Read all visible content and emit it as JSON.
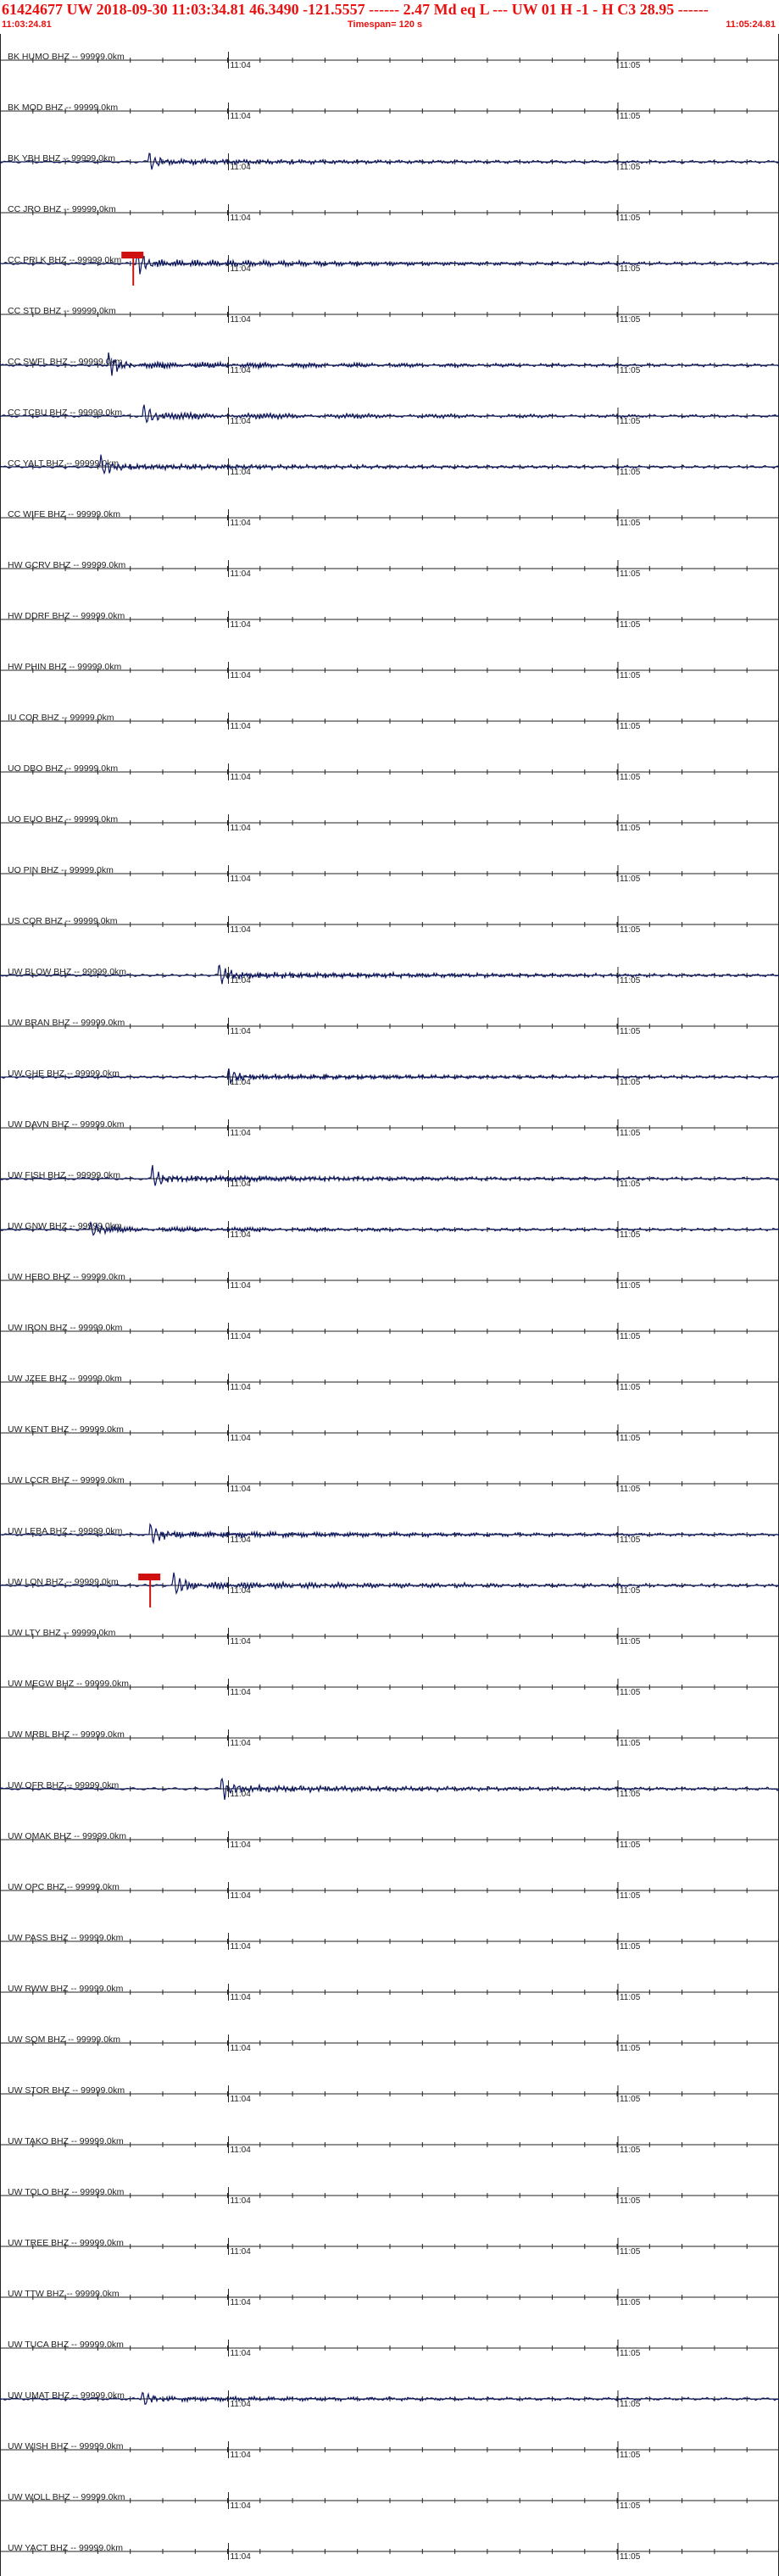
{
  "header": {
    "title": "61424677 UW 2018-09-30 11:03:34.81   46.3490 -121.5557 ------   2.47 Md  eq  L  ---       UW 01  H  -1  -  H C3   28.95 ------",
    "start_time": "11:03:24.81",
    "timespan": "Timespan= 120 s",
    "end_time": "11:05:24.81"
  },
  "colors": {
    "title_red": "#e8110f",
    "trace_navy": "#0c1660",
    "pick_red": "#d01010",
    "axis": "#222222"
  },
  "chart_data": {
    "type": "line",
    "description_type": "seismogram record section",
    "x_range_seconds": [
      0,
      120
    ],
    "time_ticks": [
      {
        "label": "11:04",
        "t": 35.19
      },
      {
        "label": "11:05",
        "t": 95.19
      }
    ],
    "label_suffix": " -- 99999.0km",
    "traces": [
      {
        "label": "BK HUMO BHZ",
        "arrival": null,
        "pick": null,
        "amp": 0
      },
      {
        "label": "BK MOD BHZ",
        "arrival": null,
        "pick": null,
        "amp": 0
      },
      {
        "label": "BK YBH BHZ",
        "arrival": 22.8,
        "pick": null,
        "amp": 12
      },
      {
        "label": "CC JRO BHZ",
        "arrival": null,
        "pick": null,
        "amp": 0
      },
      {
        "label": "CC PRLK BHZ",
        "arrival": 21.0,
        "pick": 20.4,
        "amp": 16
      },
      {
        "label": "CC STD BHZ",
        "arrival": null,
        "pick": null,
        "amp": 0
      },
      {
        "label": "CC SWFL BHZ",
        "arrival": 16.6,
        "pick": null,
        "amp": 15
      },
      {
        "label": "CC TCBU BHZ",
        "arrival": 22.0,
        "pick": null,
        "amp": 14
      },
      {
        "label": "CC YALT BHZ",
        "arrival": 15.4,
        "pick": null,
        "amp": 13
      },
      {
        "label": "CC WIFE BHZ",
        "arrival": null,
        "pick": null,
        "amp": 0
      },
      {
        "label": "HW GCRV BHZ",
        "arrival": null,
        "pick": null,
        "amp": 0
      },
      {
        "label": "HW DDRF BHZ",
        "arrival": null,
        "pick": null,
        "amp": 0
      },
      {
        "label": "HW PHIN BHZ",
        "arrival": null,
        "pick": null,
        "amp": 0
      },
      {
        "label": "IU COR BHZ",
        "arrival": null,
        "pick": null,
        "amp": 0
      },
      {
        "label": "UO DBO BHZ",
        "arrival": null,
        "pick": null,
        "amp": 0
      },
      {
        "label": "UO EUO BHZ",
        "arrival": null,
        "pick": null,
        "amp": 0
      },
      {
        "label": "UO PIN BHZ",
        "arrival": null,
        "pick": null,
        "amp": 0
      },
      {
        "label": "US COR BHZ",
        "arrival": null,
        "pick": null,
        "amp": 0
      },
      {
        "label": "UW BLOW BHZ",
        "arrival": 33.6,
        "pick": null,
        "amp": 14
      },
      {
        "label": "UW BRAN BHZ",
        "arrival": null,
        "pick": null,
        "amp": 0
      },
      {
        "label": "UW GHE BHZ",
        "arrival": 35.0,
        "pick": null,
        "amp": 12
      },
      {
        "label": "UW DAVN BHZ",
        "arrival": null,
        "pick": null,
        "amp": 0
      },
      {
        "label": "UW FISH BHZ",
        "arrival": 23.3,
        "pick": null,
        "amp": 15
      },
      {
        "label": "UW GNW BHZ",
        "arrival": 13.8,
        "pick": null,
        "amp": 11
      },
      {
        "label": "UW HEBO BHZ",
        "arrival": null,
        "pick": null,
        "amp": 0
      },
      {
        "label": "UW IRON BHZ",
        "arrival": null,
        "pick": null,
        "amp": 0
      },
      {
        "label": "UW JZEE BHZ",
        "arrival": null,
        "pick": null,
        "amp": 0
      },
      {
        "label": "UW KENT BHZ",
        "arrival": null,
        "pick": null,
        "amp": 0
      },
      {
        "label": "UW LCCR BHZ",
        "arrival": null,
        "pick": null,
        "amp": 0
      },
      {
        "label": "UW LEBA BHZ",
        "arrival": 23.0,
        "pick": null,
        "amp": 15
      },
      {
        "label": "UW LON BHZ",
        "arrival": 26.6,
        "pick": 23.0,
        "amp": 16
      },
      {
        "label": "UW LTY BHZ",
        "arrival": null,
        "pick": null,
        "amp": 0
      },
      {
        "label": "UW MEGW BHZ",
        "arrival": null,
        "pick": null,
        "amp": 0
      },
      {
        "label": "UW MRBL BHZ",
        "arrival": null,
        "pick": null,
        "amp": 0
      },
      {
        "label": "UW OFR BHZ",
        "arrival": 34.0,
        "pick": null,
        "amp": 15
      },
      {
        "label": "UW OMAK BHZ",
        "arrival": null,
        "pick": null,
        "amp": 0
      },
      {
        "label": "UW OPC BHZ",
        "arrival": null,
        "pick": null,
        "amp": 0
      },
      {
        "label": "UW PASS BHZ",
        "arrival": null,
        "pick": null,
        "amp": 0
      },
      {
        "label": "UW RWW BHZ",
        "arrival": null,
        "pick": null,
        "amp": 0
      },
      {
        "label": "UW SQM BHZ",
        "arrival": null,
        "pick": null,
        "amp": 0
      },
      {
        "label": "UW STOR BHZ",
        "arrival": null,
        "pick": null,
        "amp": 0
      },
      {
        "label": "UW TAKO BHZ",
        "arrival": null,
        "pick": null,
        "amp": 0
      },
      {
        "label": "UW TOLO BHZ",
        "arrival": null,
        "pick": null,
        "amp": 0
      },
      {
        "label": "UW TREE BHZ",
        "arrival": null,
        "pick": null,
        "amp": 0
      },
      {
        "label": "UW TTW BHZ",
        "arrival": null,
        "pick": null,
        "amp": 0
      },
      {
        "label": "UW TUCA BHZ",
        "arrival": null,
        "pick": null,
        "amp": 0
      },
      {
        "label": "UW UMAT BHZ",
        "arrival": 21.8,
        "pick": null,
        "amp": 10
      },
      {
        "label": "UW WISH BHZ",
        "arrival": null,
        "pick": null,
        "amp": 0
      },
      {
        "label": "UW WOLL BHZ",
        "arrival": null,
        "pick": null,
        "amp": 0
      },
      {
        "label": "UW YACT BHZ",
        "arrival": null,
        "pick": null,
        "amp": 0
      }
    ]
  }
}
